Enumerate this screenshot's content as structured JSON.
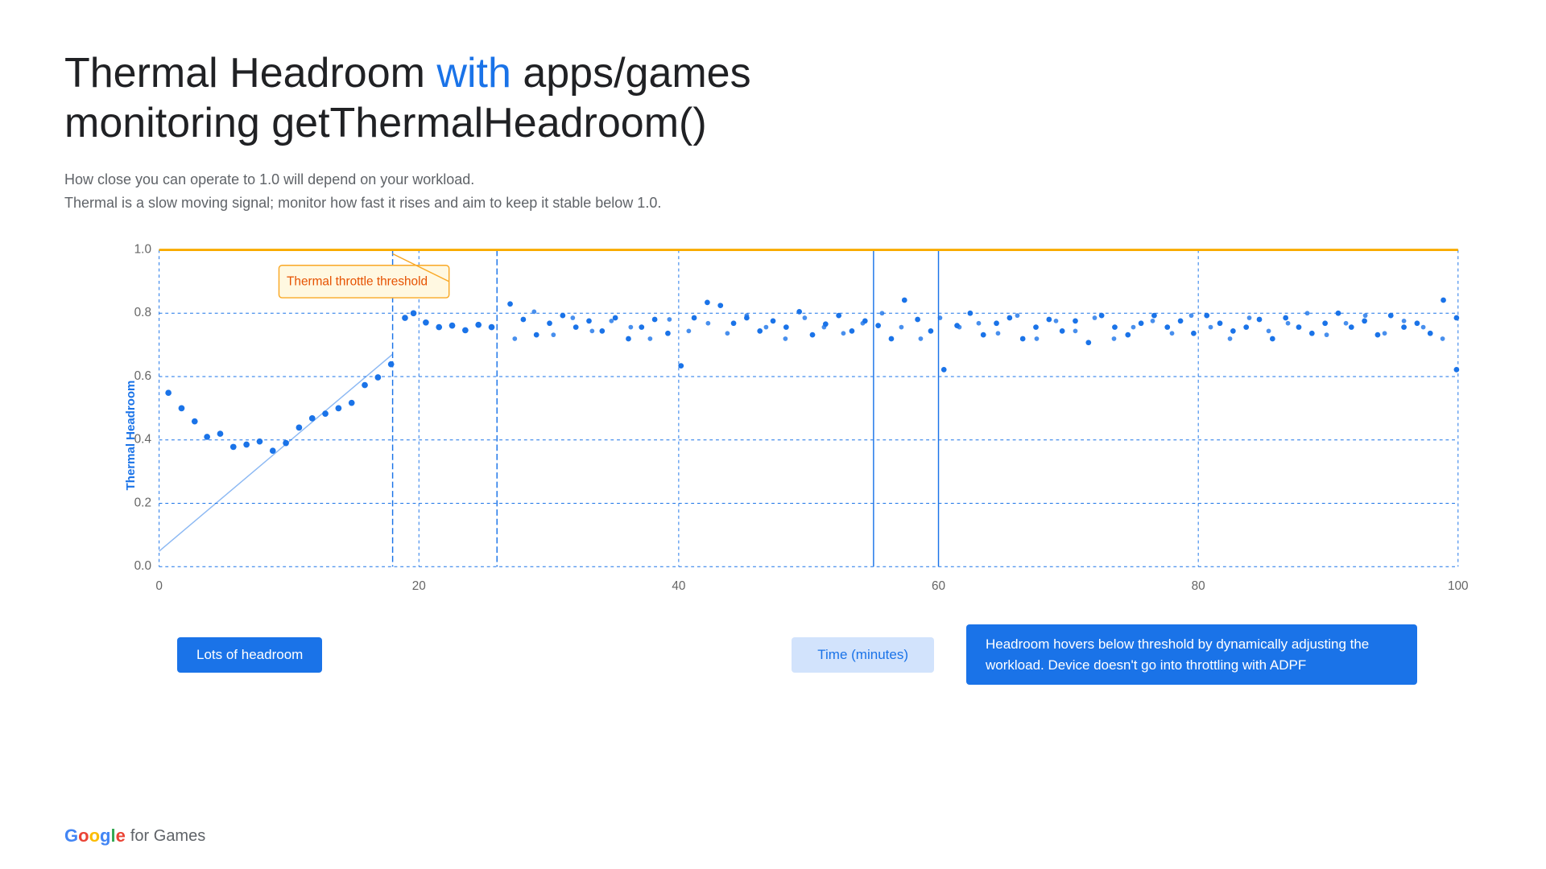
{
  "page": {
    "title_part1": "Thermal Headroom ",
    "title_with": "with",
    "title_part2": " apps/games",
    "title_line2": "monitoring getThermalHeadroom()",
    "subtitle_line1": "How close you can operate to 1.0 will depend on your workload.",
    "subtitle_line2": "Thermal is a slow moving signal; monitor how fast it rises and aim to keep it stable below 1.0.",
    "y_axis_label": "Thermal Headroom",
    "x_axis_label": "Time (minutes)",
    "tooltip_text": "Thermal throttle threshold",
    "annotation_left": "Lots of headroom",
    "annotation_center": "Time (minutes)",
    "annotation_right": "Headroom hovers below threshold by dynamically adjusting the workload. Device doesn't go into throttling with ADPF",
    "logo_google": "Google",
    "logo_for_games": "for Games"
  },
  "chart": {
    "y_ticks": [
      "0.0",
      "0.2",
      "0.4",
      "0.6",
      "0.8",
      "1.0"
    ],
    "x_ticks": [
      "0",
      "20",
      "40",
      "60",
      "80",
      "100"
    ],
    "threshold_y": 1.0,
    "threshold_color": "#f9ab00",
    "grid_color": "#1a73e8",
    "dot_color": "#1a73e8"
  },
  "colors": {
    "accent": "#1a73e8",
    "highlight": "#1a73e8",
    "threshold": "#f9ab00",
    "bg": "#ffffff",
    "text_dark": "#202124",
    "text_gray": "#5f6368"
  }
}
